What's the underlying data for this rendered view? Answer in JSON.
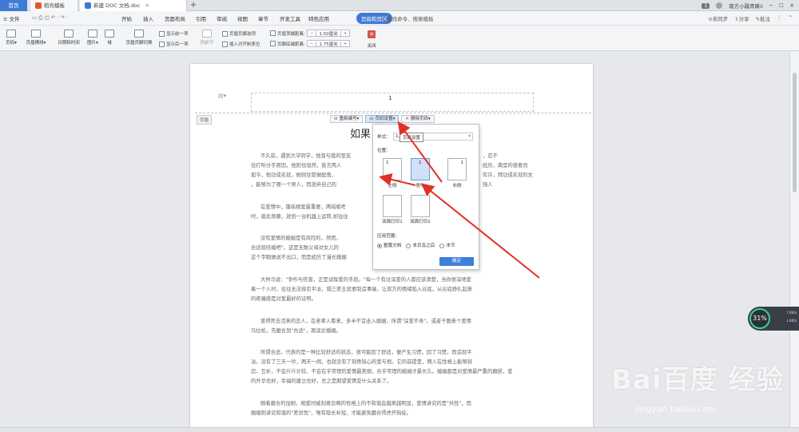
{
  "tabs": {
    "home": "首页",
    "doc1": "稻壳模板",
    "doc2": "新建 DOC 文档.doc",
    "new_tab": "+",
    "user": "南方小疆青睐ii",
    "page_badge": "1"
  },
  "menu": {
    "file": "≡ 文件",
    "items": [
      "开始",
      "插入",
      "页面布局",
      "引用",
      "审阅",
      "视图",
      "章节",
      "开发工具",
      "特色应用"
    ],
    "active": "页眉和页脚",
    "search": "Q查找命令、搜索模板",
    "unsync": "未同步",
    "share": "分享",
    "batch": "批注"
  },
  "ribbon": {
    "page_number": "页码",
    "header_footer_title": "页眉横线",
    "date_time": "日期和时间",
    "picture": "图片",
    "field": "域",
    "switch": "页眉页脚切换",
    "show_prev": "显示前一项",
    "show_next": "显示后一项",
    "same_as_prev": "同前节",
    "options": "页眉页脚选项",
    "insert_align_tab": "插入对齐制表位",
    "header_top_margin_label": "页眉顶端距离:",
    "header_top_margin_value": "1.50厘米",
    "footer_bottom_margin_label": "页脚底端距离:",
    "footer_bottom_margin_value": "1.75厘米",
    "close": "关闭"
  },
  "document": {
    "header_page_number": "1",
    "header_tag": "页眉",
    "title": "如果",
    "paragraphs": [
      "不久前，遇到大学同学，他曾与我的室友",
      "住打听分手原因，他则也坦然，直言两人",
      "如今，他功成名就，她则甘愿做配角，",
      "，能够为了哪一个男人，而放弃自己的",
      "在爱情中，瓊瑶相爱最重要，两瑶相考",
      "时，彼此频慕，放到一台机器上运转,却往往",
      "没有爱情的婚姻是有风险的，然而，",
      "合适就结婚吧\"，这是无数父母对女儿的",
      "这个字眼她说不出口，而是经历了漫长婚姻",
      "大仲马说：\"争吵与伤害，正是试探爱的手段。\"每一个有过深爱的人都应该清楚，当你很深地爱",
      "着一个人时，往往无法容忍平淡，隔三差五就要制造事端，让双方的情绪陷入谷底，从谷底挣扎起来",
      "的疼痛感是对爱最好的证明。",
      "爱得死去活来的恋人，在老辈人看来，多半不宜走入婚姻，所谓\"深爱不寿\"。或者干脆来个爱情",
      "马拉松，先磨合到\"合适\"，再谈论婚姻。",
      "所谓合适，代表的是一种比较舒适的状态，很可能因了舒适，便产生习惯，因了习惯，而造就平",
      "淡。没有了三天一吵，两天一闹，也就没有了刻骨铭心的爱与恨。它的前提是，两人在性格上能够容",
      "忍、互补，不会斤斤计较、不会在乎常理的爱情最美丽，合乎常理的婚姻才最长久。婚姻都是对爱情最严重的磨损，爱",
      "的升华也好，幸福的建立也好，总之是期望爱情变什么关系了。",
      "随着磨合的加剧，相爱时被刻意忽略的性格上的不和谐会越来越明显，爱情讲究的是\"共性\"，而",
      "婚姻则讲究和谐的\"差异性\"，唯有取长补短，才能避免磨合得虎开狗绽。"
    ],
    "right_fragments": [
      "，忍不",
      "经历，典型的很要良",
      "有许，拜功成名就的女强人"
    ]
  },
  "page_number_toolbar": {
    "renumber": "重新编号",
    "settings": "页码设置",
    "delete": "删除页码"
  },
  "popup": {
    "style_label": "样式：",
    "style_value": "1,",
    "tooltip": "页码设置",
    "position_label": "位置：",
    "positions": [
      "左侧",
      "居中",
      "右侧",
      "双面打印1",
      "双面打印2"
    ],
    "position_numbers": [
      "1",
      "1",
      "1",
      "",
      ""
    ],
    "scope_label": "应用范围：",
    "scope_options": [
      "整篇文档",
      "本页及之后",
      "本节"
    ],
    "ok": "确定"
  },
  "overlay": {
    "percent": "31%",
    "up": "0K/s",
    "down": "0K/s"
  },
  "watermark": {
    "brand": "Bai百度 经验",
    "url": "jingyan.baidu.com"
  },
  "colors": {
    "accent": "#3f7bd6",
    "popup_selected": "#cfe0f7",
    "arrow": "#e0302a",
    "close": "#d9534f"
  }
}
